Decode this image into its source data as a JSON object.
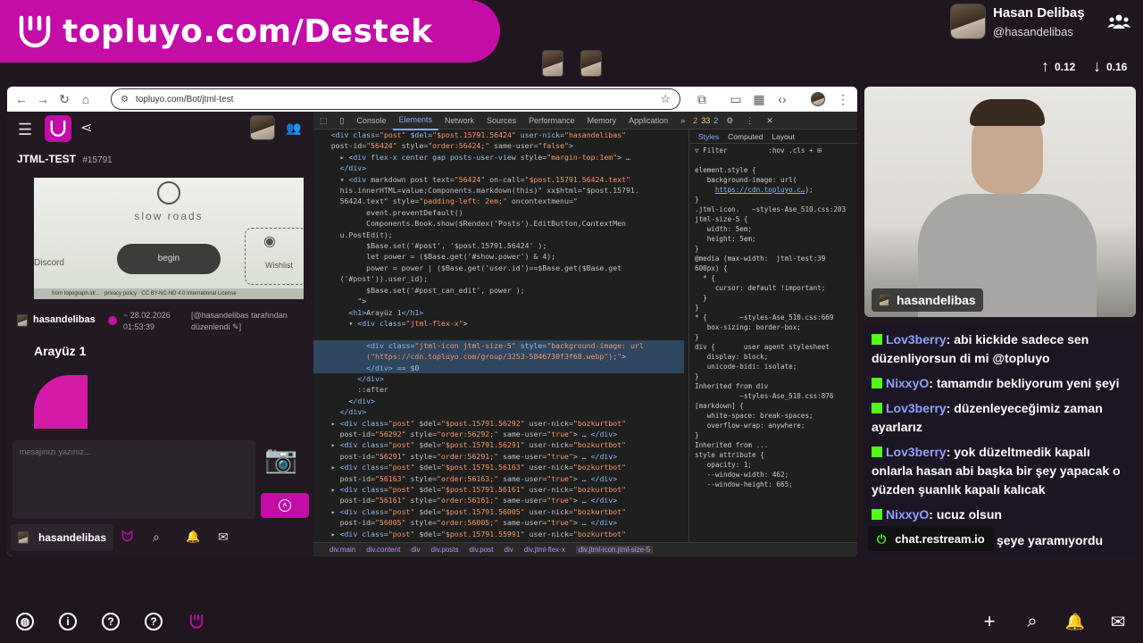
{
  "banner": {
    "text": "topluyo.com/Destek"
  },
  "profile": {
    "name": "Hasan Delibaş",
    "handle": "@hasandelibas"
  },
  "stats": {
    "up": "0.12",
    "down": "0.16"
  },
  "browser": {
    "url": "topluyo.com/Bot/jtml-test",
    "devtools_tabs": [
      "Console",
      "Elements",
      "Network",
      "Sources",
      "Performance",
      "Memory",
      "Application"
    ],
    "active_tab": "Elements",
    "error_count": "2",
    "warning_count": "33",
    "info_count": "2",
    "styles_tabs": [
      "Styles",
      "Computed",
      "Layout"
    ],
    "breadcrumbs": [
      "div.main",
      "div.content",
      "div",
      "div.posts",
      "div.post",
      "div",
      "div.jtml-flex-x",
      "div.jtml-icon.jtml-size-5"
    ]
  },
  "app": {
    "channel": "JTML-TEST",
    "channel_id": "#15791",
    "game_title": "slow roads",
    "game_begin": "begin",
    "game_left": "Discord",
    "game_right": "Wishlist",
    "game_footer": "from topograph.id/... · privacy policy · CC BY-NC-ND 4.0 International License",
    "post_user": "hasandelibas",
    "post_date": "~ 28.02.2026 01:53:39",
    "post_edit": "[@hasandelibas tarafından düzenlendi ✎]",
    "post_title": "Arayüz 1",
    "input_placeholder": "mesajınızı yazınız...",
    "footer_user": "hasandelibas"
  },
  "cam_label": "hasandelibas",
  "chat": [
    {
      "user": "Lov3berry",
      "text": "abi kickide sadece sen düzenliyorsun di mi @topluyo"
    },
    {
      "user": "NixxyO",
      "text": "tamamdır bekliyorum yeni şeyi"
    },
    {
      "user": "Lov3berry",
      "text": "düzenleyeceğimiz zaman ayarlarız"
    },
    {
      "user": "Lov3berry",
      "text": "yok düzeltmedik kapalı onlarla hasan abi başka bir şey yapacak o yüzden şuanlık kapalı kalıcak"
    },
    {
      "user": "NixxyO",
      "text": "ucuz olsun"
    }
  ],
  "chat_overlay": {
    "source": "chat.restream.io",
    "partial": "şeye yaramıyordu"
  },
  "colors": {
    "accent": "#c40ca6",
    "kick": "#53fc18",
    "chat_user": "#8fa0ff"
  }
}
